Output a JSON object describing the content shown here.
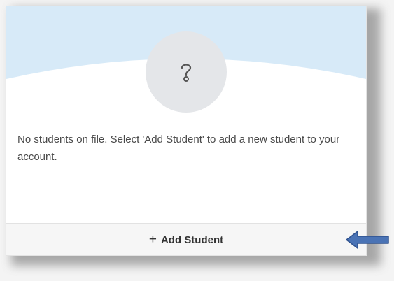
{
  "card": {
    "avatar_icon": "question-mark-icon",
    "message": "No students on file. Select 'Add Student' to add a new student to your account.",
    "add_button": {
      "plus": "+",
      "label": "Add Student"
    }
  },
  "annotation": {
    "arrow_icon": "left-arrow-icon",
    "arrow_color": "#4a73b5"
  },
  "colors": {
    "header_bg": "#d7eaf8",
    "avatar_bg": "#e4e6e9",
    "footer_bg": "#f6f6f6",
    "text": "#4a4a4a"
  }
}
